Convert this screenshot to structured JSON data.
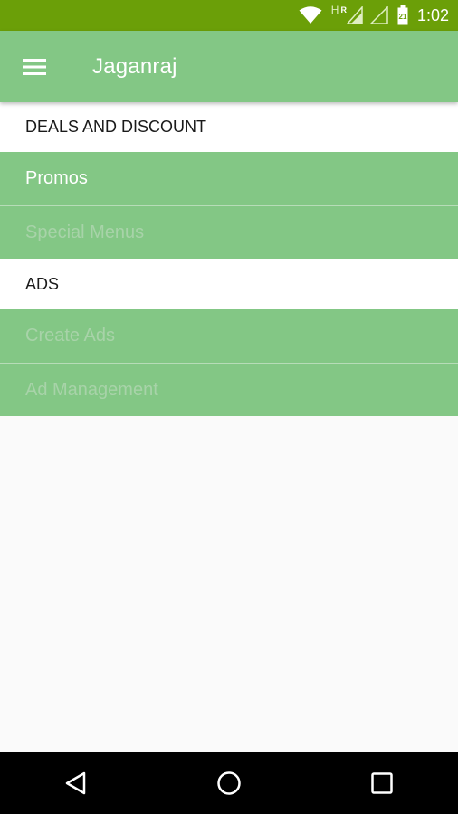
{
  "status_bar": {
    "network_type": "H",
    "roaming": "R",
    "time": "1:02",
    "icons": [
      "wifi-icon",
      "signal-roaming-icon",
      "signal-empty-icon",
      "battery-icon"
    ],
    "background": "#6b9f08"
  },
  "app_bar": {
    "title": "Jaganraj",
    "menu_icon": "hamburger-menu-icon",
    "background": "#83c785"
  },
  "sections": [
    {
      "header": "DEALS AND DISCOUNT",
      "items": [
        {
          "label": "Promos",
          "state": "active"
        },
        {
          "label": "Special Menus",
          "state": "disabled"
        }
      ]
    },
    {
      "header": "ADS",
      "items": [
        {
          "label": "Create Ads",
          "state": "disabled"
        },
        {
          "label": "Ad Management",
          "state": "disabled"
        }
      ]
    }
  ],
  "nav_bar": {
    "buttons": [
      "back-icon",
      "home-icon",
      "recents-icon"
    ]
  },
  "colors": {
    "accent_green": "#83c785",
    "active_text": "#ffffff",
    "disabled_text": "#a8d3a9"
  }
}
